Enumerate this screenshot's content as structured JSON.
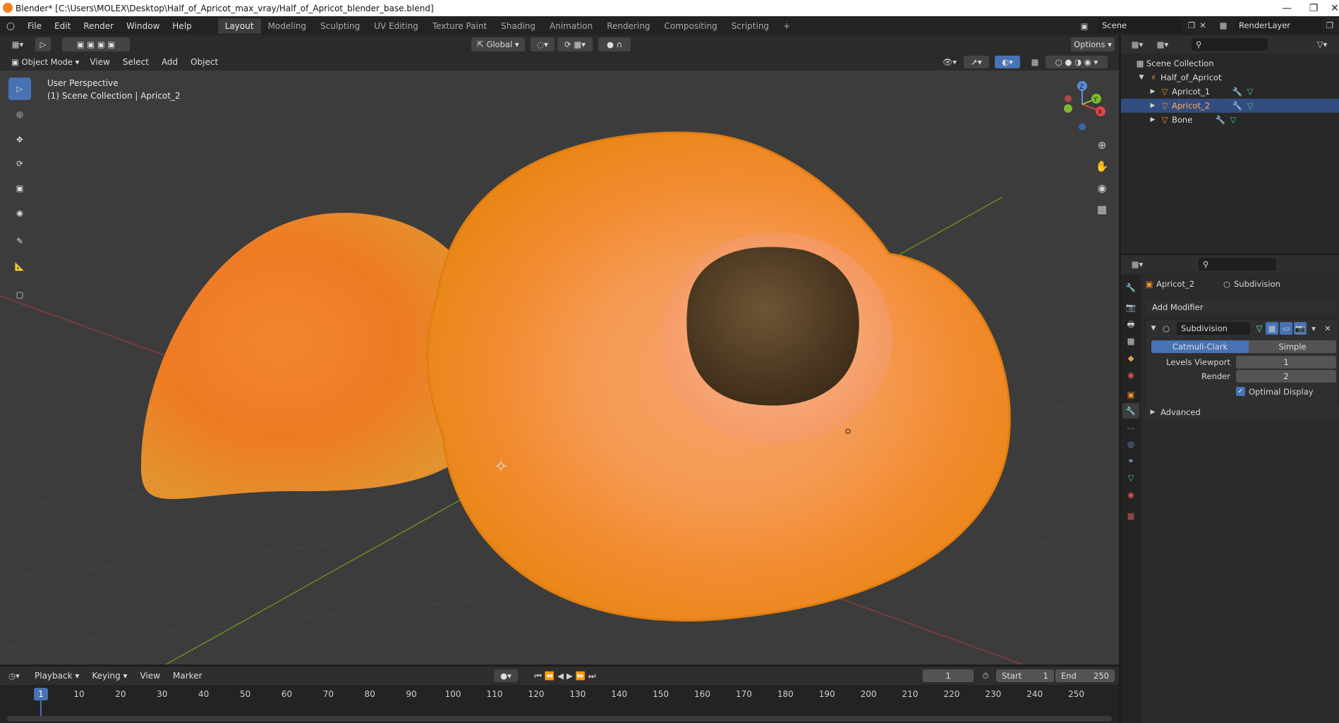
{
  "window": {
    "title": "Blender* [C:\\Users\\MOLEX\\Desktop\\Half_of_Apricot_max_vray/Half_of_Apricot_blender_base.blend]"
  },
  "menu": [
    "File",
    "Edit",
    "Render",
    "Window",
    "Help"
  ],
  "workspaces": [
    "Layout",
    "Modeling",
    "Sculpting",
    "UV Editing",
    "Texture Paint",
    "Shading",
    "Animation",
    "Rendering",
    "Compositing",
    "Scripting"
  ],
  "active_workspace": "Layout",
  "scene": {
    "name": "Scene",
    "render_layer": "RenderLayer"
  },
  "viewport": {
    "mode": "Object Mode",
    "menus": [
      "View",
      "Select",
      "Add",
      "Object"
    ],
    "transform_orientation": "Global",
    "options_label": "Options",
    "overlay_line1": "User Perspective",
    "overlay_line2": "(1) Scene Collection | Apricot_2",
    "gizmo": {
      "x": "X",
      "y": "Y",
      "z": "Z"
    }
  },
  "outliner": {
    "root": "Scene Collection",
    "collection": "Half_of_Apricot",
    "items": [
      {
        "name": "Apricot_1",
        "selected": false
      },
      {
        "name": "Apricot_2",
        "selected": true
      },
      {
        "name": "Bone",
        "selected": false
      }
    ]
  },
  "properties": {
    "object": "Apricot_2",
    "modifier_breadcrumb": "Subdivision",
    "add_modifier": "Add Modifier",
    "modifier_name": "Subdivision",
    "types": [
      "Catmull-Clark",
      "Simple"
    ],
    "active_type": "Catmull-Clark",
    "levels_viewport_label": "Levels Viewport",
    "levels_viewport": "1",
    "render_label": "Render",
    "render": "2",
    "optimal_display": "Optimal Display",
    "advanced": "Advanced"
  },
  "timeline": {
    "menus": [
      "Playback",
      "Keying",
      "View",
      "Marker"
    ],
    "current_frame": "1",
    "start_label": "Start",
    "start": "1",
    "end_label": "End",
    "end": "250",
    "ticks": [
      "10",
      "20",
      "30",
      "40",
      "50",
      "60",
      "70",
      "80",
      "90",
      "100",
      "110",
      "120",
      "130",
      "140",
      "150",
      "160",
      "170",
      "180",
      "190",
      "200",
      "210",
      "220",
      "230",
      "240",
      "250"
    ],
    "playhead": "1"
  },
  "colors": {
    "accent": "#4772b3",
    "selected_row": "#334d80",
    "grid_x": "#8b3b3b",
    "grid_y": "#6b8e23"
  }
}
